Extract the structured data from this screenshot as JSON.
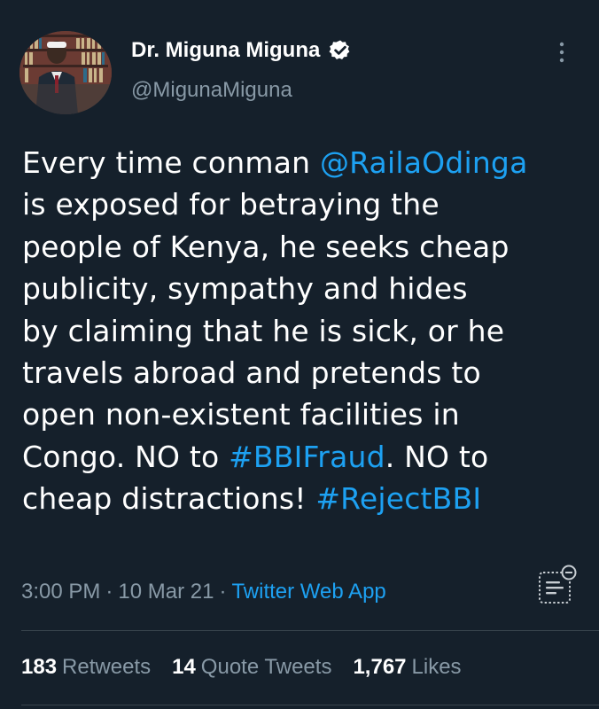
{
  "author": {
    "display_name": "Dr. Miguna Miguna",
    "handle": "@MigunaMiguna",
    "verified": true,
    "avatar_icon": "profile-photo"
  },
  "tweet": {
    "lines": [
      [
        {
          "text": "Every time conman ",
          "type": "text"
        },
        {
          "text": "@RailaOdinga",
          "type": "mention"
        }
      ],
      [
        {
          "text": "is exposed for betraying the",
          "type": "text"
        }
      ],
      [
        {
          "text": "people of Kenya, he seeks cheap",
          "type": "text"
        }
      ],
      [
        {
          "text": "publicity, sympathy and hides",
          "type": "text"
        }
      ],
      [
        {
          "text": "by claiming that he is sick, or he",
          "type": "text"
        }
      ],
      [
        {
          "text": "travels abroad and pretends to",
          "type": "text"
        }
      ],
      [
        {
          "text": "open non-existent facilities in",
          "type": "text"
        }
      ],
      [
        {
          "text": "Congo. NO to ",
          "type": "text"
        },
        {
          "text": "#BBIFraud",
          "type": "hashtag"
        },
        {
          "text": ". NO to",
          "type": "text"
        }
      ],
      [
        {
          "text": "cheap distractions! ",
          "type": "text"
        },
        {
          "text": "#RejectBBI",
          "type": "hashtag"
        }
      ]
    ]
  },
  "meta": {
    "time": "3:00 PM",
    "separator": "·",
    "date": "10 Mar 21",
    "source": "Twitter Web App"
  },
  "stats": {
    "retweets_count": "183",
    "retweets_label": "Retweets",
    "quotes_count": "14",
    "quotes_label": "Quote Tweets",
    "likes_count": "1,767",
    "likes_label": "Likes"
  },
  "icons": {
    "verified": "verified-badge-icon",
    "more": "more-vertical-icon",
    "analytics": "view-tweet-activity-icon"
  },
  "colors": {
    "background": "#15202b",
    "link": "#1da1f2",
    "secondary_text": "#8899a6",
    "divider": "#38444d"
  }
}
